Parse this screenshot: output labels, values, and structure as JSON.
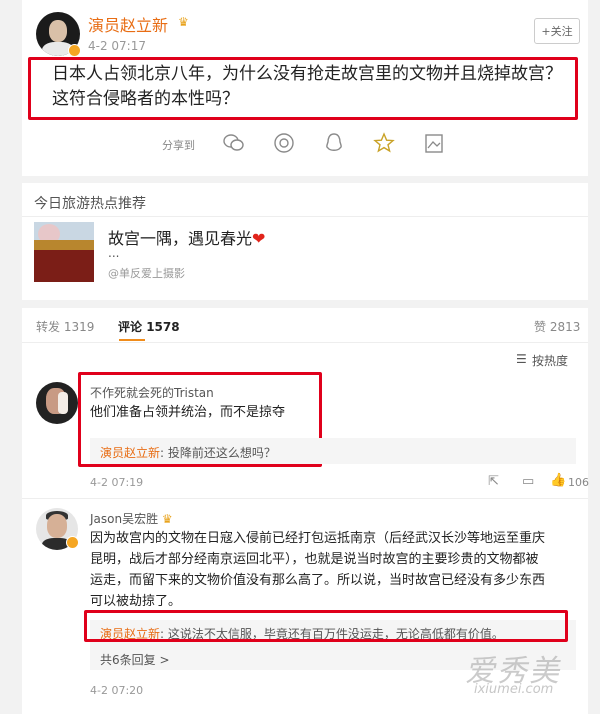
{
  "post": {
    "author": "演员赵立新",
    "timestamp": "4-2 07:17",
    "follow_label": "+关注",
    "content": "日本人占领北京八年，为什么没有抢走故宫里的文物并且烧掉故宫？这符合侵略者的本性吗？",
    "share_label": "分享到",
    "share_icons": [
      "wechat-icon",
      "moments-icon",
      "qq-icon",
      "qzone-star-icon",
      "save-image-icon"
    ]
  },
  "travel": {
    "section_title": "今日旅游热点推荐",
    "title": "故宫一隅，遇见春光",
    "ellipsis": "...",
    "credit": "@单反爱上摄影"
  },
  "comments_bar": {
    "repost_label": "转发",
    "repost_count": "1319",
    "comment_label": "评论",
    "comment_count": "1578",
    "like_label": "赞",
    "like_count": "2813",
    "sort_label": "按热度"
  },
  "comments": [
    {
      "author": "不作死就会死的Tristan",
      "text": "他们准备占领并统治，而不是掠夺",
      "reply_author": "演员赵立新",
      "reply_text": "投降前还这么想吗？",
      "timestamp": "4-2 07:19",
      "likes": "106"
    },
    {
      "author": "Jason吴宏胜",
      "text_lines": [
        "因为故宫内的文物在日寇入侵前已经打包运抵南京（后经武汉长沙等地运至重庆",
        "昆明，战后才部分经南京运回北平），也就是说当时故宫的主要珍贵的文物都被",
        "运走，而留下来的文物价值没有那么高了。所以说，当时故宫已经没有多少东西",
        "可以被劫掠了。"
      ],
      "reply_author": "演员赵立新",
      "reply_text": "这说法不太信服，毕竟还有百万件没运走，无论高低都有价值。",
      "more_replies": "共6条回复 >",
      "timestamp": "4-2 07:20"
    }
  ],
  "watermark": {
    "main": "爱秀美",
    "sub": "ixiumei.com"
  },
  "colors": {
    "author_orange": "#e86d14",
    "highlight_red": "#e0001b",
    "tab_underline": "#f08c1b"
  }
}
